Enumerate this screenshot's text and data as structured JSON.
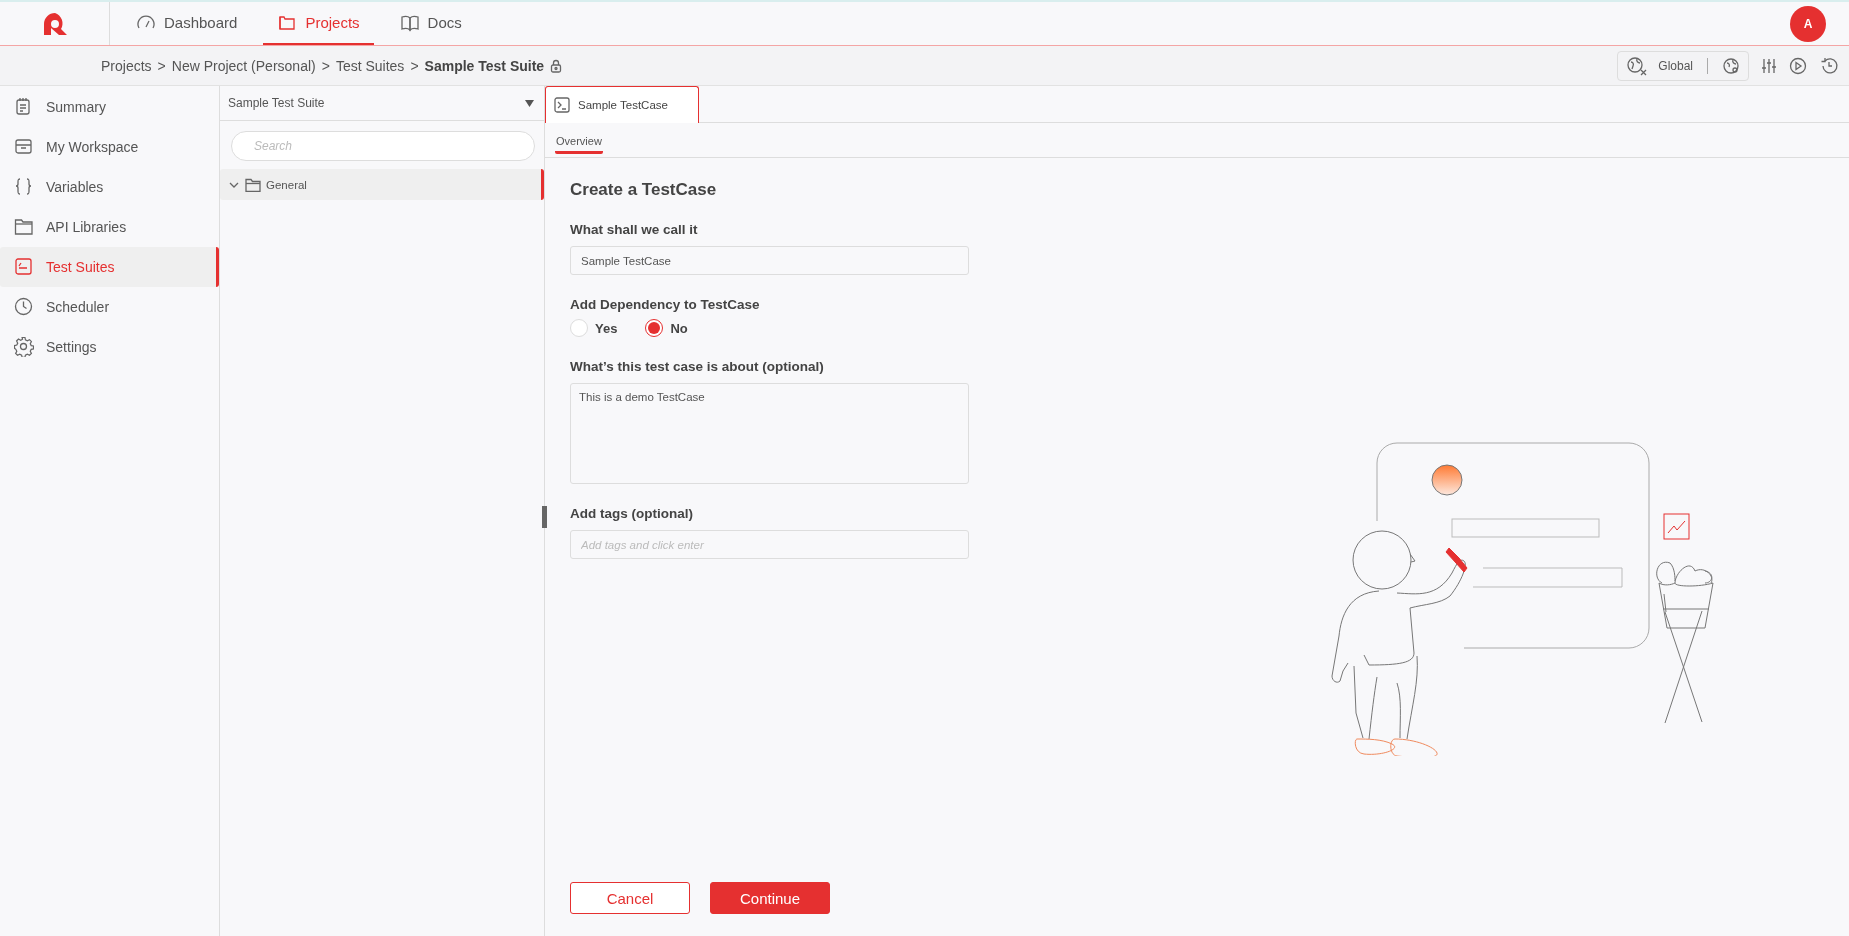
{
  "top_nav": {
    "items": [
      {
        "label": "Dashboard",
        "selected": false
      },
      {
        "label": "Projects",
        "selected": true
      },
      {
        "label": "Docs",
        "selected": false
      }
    ],
    "avatar": "A"
  },
  "breadcrumb": {
    "items": [
      "Projects",
      "New Project (Personal)",
      "Test Suites"
    ],
    "separator": ">",
    "current": "Sample Test Suite"
  },
  "toolbar": {
    "environment": "Global"
  },
  "sidebar": {
    "items": [
      {
        "label": "Summary",
        "selected": false
      },
      {
        "label": "My Workspace",
        "selected": false
      },
      {
        "label": "Variables",
        "selected": false
      },
      {
        "label": "API Libraries",
        "selected": false
      },
      {
        "label": "Test Suites",
        "selected": true
      },
      {
        "label": "Scheduler",
        "selected": false
      },
      {
        "label": "Settings",
        "selected": false
      }
    ]
  },
  "tree": {
    "suite": "Sample Test Suite",
    "search_placeholder": "Search",
    "nodes": [
      {
        "label": "General",
        "expanded": true,
        "selected": true
      }
    ]
  },
  "tabs": [
    {
      "label": "Sample TestCase",
      "selected": true
    }
  ],
  "subtabs": [
    {
      "label": "Overview",
      "selected": true
    }
  ],
  "form": {
    "title": "Create a TestCase",
    "name_label": "What shall we call it",
    "name_value": "Sample TestCase",
    "dependency_label": "Add Dependency to TestCase",
    "dependency_options": [
      {
        "label": "Yes",
        "selected": false
      },
      {
        "label": "No",
        "selected": true
      }
    ],
    "description_label": "What’s this test case is about (optional)",
    "description_value": "This is a demo TestCase",
    "tags_label": "Add tags (optional)",
    "tags_placeholder": "Add tags and click enter"
  },
  "buttons": {
    "cancel": "Cancel",
    "continue": "Continue"
  }
}
